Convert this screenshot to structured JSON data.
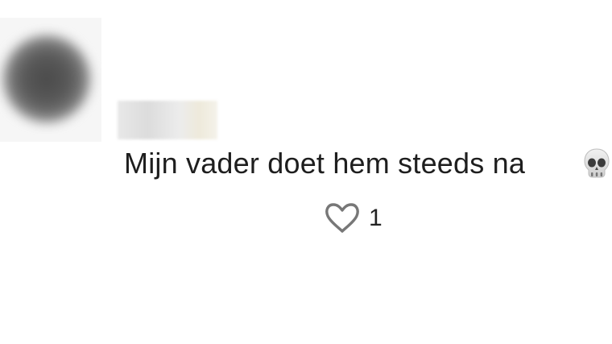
{
  "comment": {
    "text": "Mijn vader doet hem steeds na",
    "emoji_icon": "skull-icon",
    "like_icon": "heart-outline-icon",
    "like_count": "1",
    "avatar_blurred": true,
    "username_blurred": true
  }
}
